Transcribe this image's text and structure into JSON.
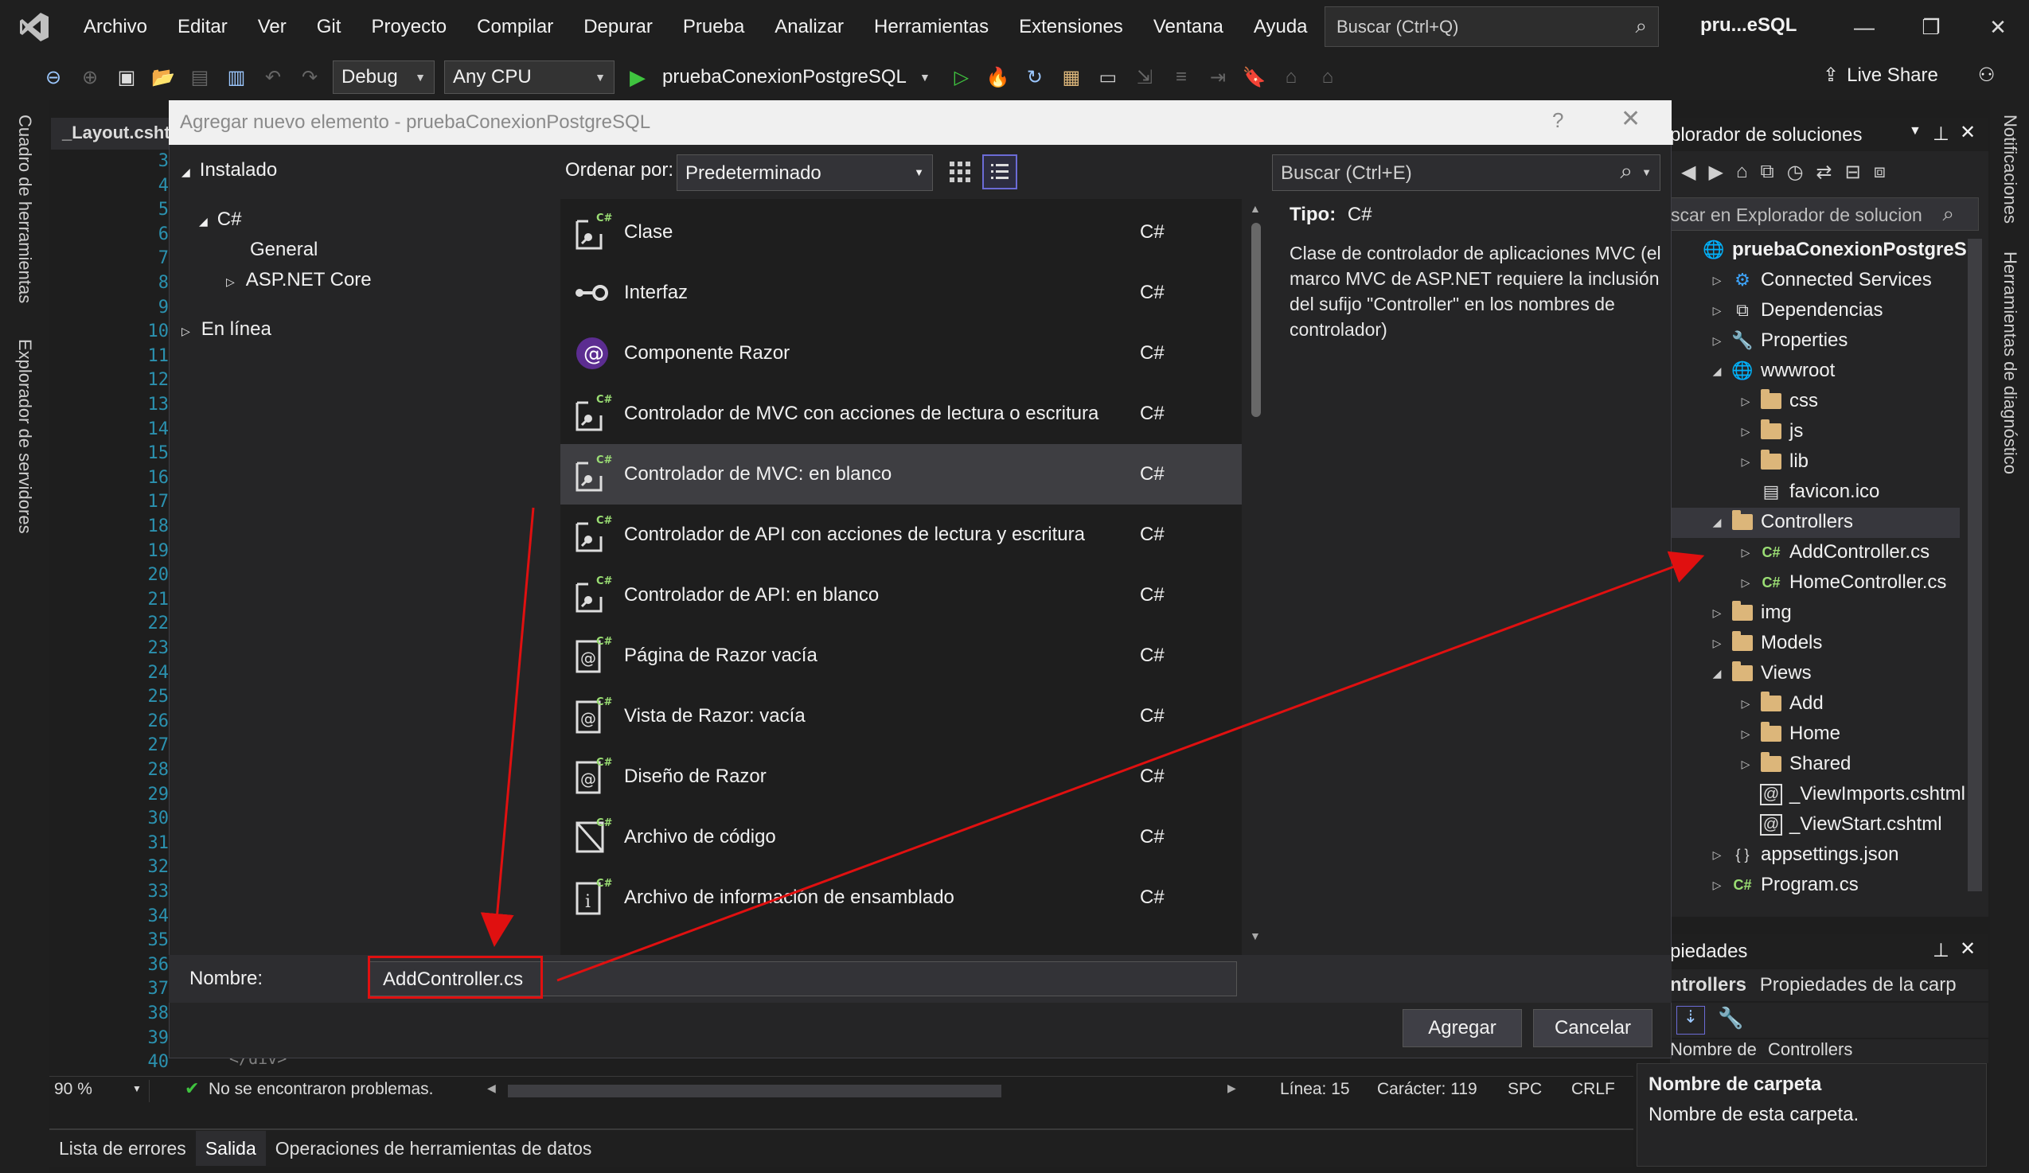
{
  "menubar": {
    "items": [
      "Archivo",
      "Editar",
      "Ver",
      "Git",
      "Proyecto",
      "Compilar",
      "Depurar",
      "Prueba",
      "Analizar",
      "Herramientas",
      "Extensiones",
      "Ventana",
      "Ayuda"
    ],
    "search_placeholder": "Buscar (Ctrl+Q)",
    "title": "pru...eSQL"
  },
  "toolbar": {
    "config": "Debug",
    "platform": "Any CPU",
    "run_target": "pruebaConexionPostgreSQL",
    "live_share": "Live Share"
  },
  "left_rail": {
    "toolbox": "Cuadro de herramientas",
    "server_explorer": "Explorador de servidores"
  },
  "right_rail": {
    "notifications": "Notificaciones",
    "diagnostics": "Herramientas de diagnóstico"
  },
  "editor": {
    "tab": "_Layout.csht",
    "line_numbers": [
      "3",
      "4",
      "5",
      "6",
      "7",
      "8",
      "9",
      "10",
      "11",
      "12",
      "13",
      "14",
      "15",
      "16",
      "17",
      "18",
      "19",
      "20",
      "21",
      "22",
      "23",
      "24",
      "25",
      "26",
      "27",
      "28",
      "29",
      "30",
      "31",
      "32",
      "33",
      "34",
      "35",
      "36",
      "37",
      "38",
      "39",
      "40"
    ],
    "code_snippet": "</div>",
    "zoom": "90 %",
    "problems": "No se encontraron problemas.",
    "line": "Línea: 15",
    "char": "Carácter: 119",
    "spc": "SPC",
    "crlf": "CRLF"
  },
  "bottom_tabs": [
    "Lista de errores",
    "Salida",
    "Operaciones de herramientas de datos"
  ],
  "dialog": {
    "title": "Agregar nuevo elemento - pruebaConexionPostgreSQL",
    "help": "?",
    "close": "✕",
    "tree": {
      "installed": "Instalado",
      "csharp": "C#",
      "general": "General",
      "aspnet": "ASP.NET Core",
      "online": "En línea"
    },
    "sort_label": "Ordenar por:",
    "sort_value": "Predeterminado",
    "search_placeholder": "Buscar (Ctrl+E)",
    "templates": [
      {
        "name": "Clase",
        "lang": "C#",
        "icon": "class-icon"
      },
      {
        "name": "Interfaz",
        "lang": "C#",
        "icon": "interface-icon"
      },
      {
        "name": "Componente Razor",
        "lang": "C#",
        "icon": "razor-component-icon"
      },
      {
        "name": "Controlador de MVC con acciones de lectura o escritura",
        "lang": "C#",
        "icon": "controller-icon"
      },
      {
        "name": "Controlador de MVC: en blanco",
        "lang": "C#",
        "icon": "controller-icon"
      },
      {
        "name": "Controlador de API con acciones de lectura y escritura",
        "lang": "C#",
        "icon": "controller-icon"
      },
      {
        "name": "Controlador de API: en blanco",
        "lang": "C#",
        "icon": "controller-icon"
      },
      {
        "name": "Página de Razor vacía",
        "lang": "C#",
        "icon": "razor-page-icon"
      },
      {
        "name": "Vista de Razor: vacía",
        "lang": "C#",
        "icon": "razor-page-icon"
      },
      {
        "name": "Diseño de Razor",
        "lang": "C#",
        "icon": "razor-page-icon"
      },
      {
        "name": "Archivo de código",
        "lang": "C#",
        "icon": "code-file-icon"
      },
      {
        "name": "Archivo de información de ensamblado",
        "lang": "C#",
        "icon": "assembly-info-icon"
      }
    ],
    "selected_index": 4,
    "detail": {
      "type_label": "Tipo:",
      "type_value": "C#",
      "description": "Clase de controlador de aplicaciones MVC (el marco MVC de ASP.NET requiere la inclusión del sufijo \"Controller\" en los nombres de controlador)"
    },
    "name_label": "Nombre:",
    "name_value": "AddController.cs",
    "add_button": "Agregar",
    "cancel_button": "Cancelar"
  },
  "solution_explorer": {
    "title": "plorador de soluciones",
    "search_placeholder": "scar en Explorador de solucion",
    "items": [
      {
        "label": "pruebaConexionPostgreS(",
        "depth": 0,
        "exp": "",
        "icon": "globe",
        "bold": true
      },
      {
        "label": "Connected Services",
        "depth": 1,
        "exp": "▷",
        "icon": "services"
      },
      {
        "label": "Dependencias",
        "depth": 1,
        "exp": "▷",
        "icon": "deps"
      },
      {
        "label": "Properties",
        "depth": 1,
        "exp": "▷",
        "icon": "props"
      },
      {
        "label": "wwwroot",
        "depth": 1,
        "exp": "◢",
        "icon": "globe"
      },
      {
        "label": "css",
        "depth": 2,
        "exp": "▷",
        "icon": "folder"
      },
      {
        "label": "js",
        "depth": 2,
        "exp": "▷",
        "icon": "folder"
      },
      {
        "label": "lib",
        "depth": 2,
        "exp": "▷",
        "icon": "folder"
      },
      {
        "label": "favicon.ico",
        "depth": 2,
        "exp": "",
        "icon": "file"
      },
      {
        "label": "Controllers",
        "depth": 1,
        "exp": "◢",
        "icon": "folder"
      },
      {
        "label": "AddController.cs",
        "depth": 2,
        "exp": "▷",
        "icon": "cs"
      },
      {
        "label": "HomeController.cs",
        "depth": 2,
        "exp": "▷",
        "icon": "cs"
      },
      {
        "label": "img",
        "depth": 1,
        "exp": "▷",
        "icon": "folder"
      },
      {
        "label": "Models",
        "depth": 1,
        "exp": "▷",
        "icon": "folder"
      },
      {
        "label": "Views",
        "depth": 1,
        "exp": "◢",
        "icon": "folder"
      },
      {
        "label": "Add",
        "depth": 2,
        "exp": "▷",
        "icon": "folder"
      },
      {
        "label": "Home",
        "depth": 2,
        "exp": "▷",
        "icon": "folder"
      },
      {
        "label": "Shared",
        "depth": 2,
        "exp": "▷",
        "icon": "folder"
      },
      {
        "label": "_ViewImports.cshtml",
        "depth": 2,
        "exp": "",
        "icon": "razor"
      },
      {
        "label": "_ViewStart.cshtml",
        "depth": 2,
        "exp": "",
        "icon": "razor"
      },
      {
        "label": "appsettings.json",
        "depth": 1,
        "exp": "▷",
        "icon": "json"
      },
      {
        "label": "Program.cs",
        "depth": 1,
        "exp": "▷",
        "icon": "cs"
      }
    ]
  },
  "properties": {
    "title": "piedades",
    "object": "ntrollers",
    "object_desc": "Propiedades de la carp",
    "row_name": "Nombre de",
    "row_value": "Controllers",
    "desc_title": "Nombre de carpeta",
    "desc_text": "Nombre de esta carpeta."
  },
  "colors": {
    "accent": "#6b6bd6",
    "annotation": "#e01010",
    "folder": "#dcb67a",
    "csharp": "#9bde74",
    "line_number": "#2b91af"
  }
}
